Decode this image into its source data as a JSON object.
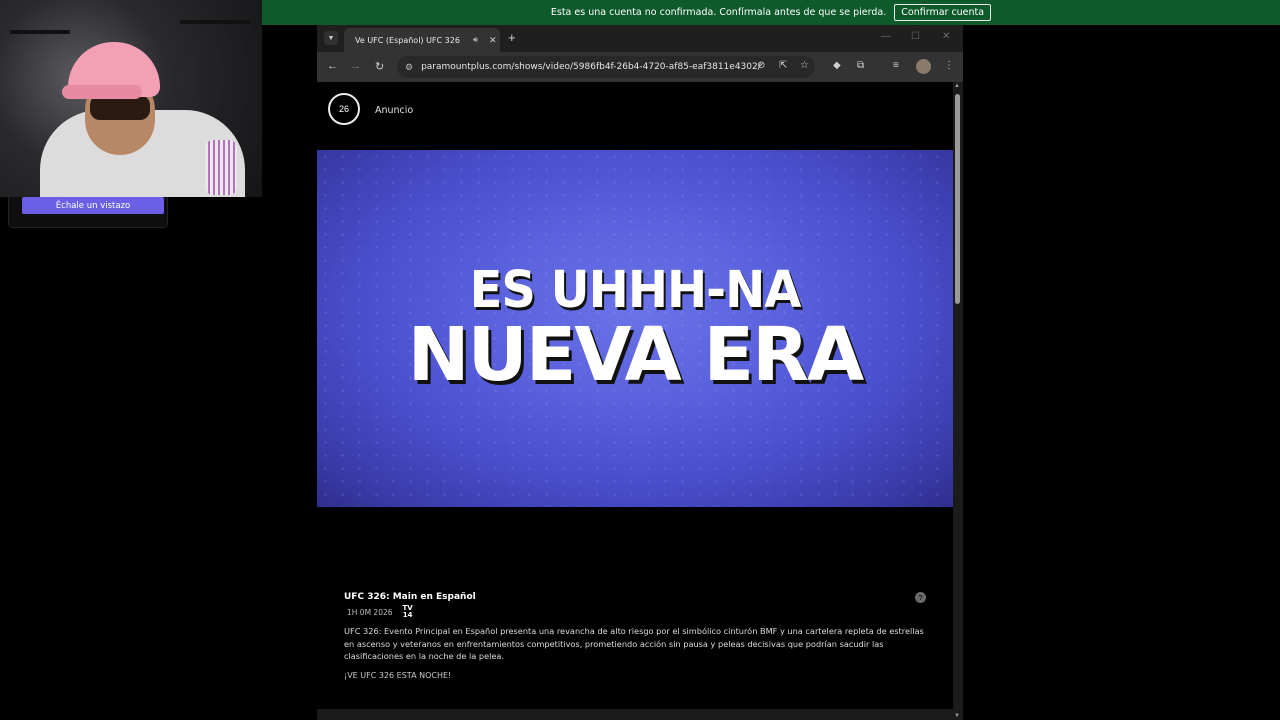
{
  "banner": {
    "message": "Esta es una cuenta no confirmada. Confírmala antes de que se pierda.",
    "confirm_label": "Confirmar cuenta"
  },
  "widget": {
    "button_label": "Échale un vistazo"
  },
  "browser": {
    "tab_title": "Ve UFC (Español) UFC 326",
    "url": "paramountplus.com/shows/video/5986fb4f-26b4-4720-af85-eaf3811e4302/"
  },
  "ad": {
    "countdown": "26",
    "label": "Anuncio"
  },
  "video": {
    "line1": "ES UHHH-NA",
    "line2": "NUEVA ERA"
  },
  "details": {
    "title": "UFC 326: Main en Español",
    "meta": "1H 0M 2026",
    "rating_top": "TV",
    "rating_bottom": "14",
    "description": "UFC 326: Evento Principal en Español presenta una revancha de alto riesgo por el simbólico cinturón BMF y una cartelera repleta de estrellas en ascenso y veteranos en enfrentamientos competitivos, prometiendo acción sin pausa y peleas decisivas que podrían sacudir las clasificaciones en la noche de la pelea.",
    "cta": "¡VE UFC 326 ESTA NOCHE!"
  },
  "colors": {
    "banner_bg": "#0e5a2a",
    "video_blue": "#5960dc",
    "widget_button": "#6b5fe6"
  }
}
